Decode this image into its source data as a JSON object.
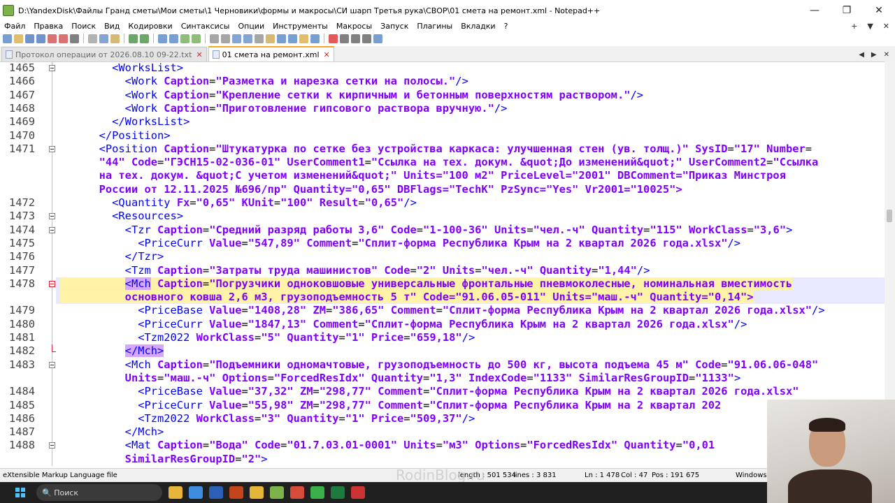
{
  "window": {
    "title": "D:\\YandexDisk\\Файлы Гранд сметы\\Мои сметы\\1 Черновики\\формы и макросы\\СИ шарп Третья рука\\СВОР\\01 смета на ремонт.xml - Notepad++",
    "minimize": "—",
    "maximize": "❐",
    "close": "✕"
  },
  "menu": {
    "items": [
      "Файл",
      "Правка",
      "Поиск",
      "Вид",
      "Кодировки",
      "Синтаксисы",
      "Опции",
      "Инструменты",
      "Макросы",
      "Запуск",
      "Плагины",
      "Вкладки",
      "?"
    ],
    "right": [
      "+",
      "▼",
      "✕"
    ]
  },
  "toolbar": {
    "icons": [
      "new-file-icon",
      "open-file-icon",
      "save-icon",
      "save-all-icon",
      "close-icon",
      "close-all-icon",
      "print-icon",
      "cut-icon",
      "copy-icon",
      "paste-icon",
      "undo-icon",
      "redo-icon",
      "find-icon",
      "replace-icon",
      "zoom-in-icon",
      "zoom-out-icon",
      "sync-v-icon",
      "sync-h-icon",
      "word-wrap-icon",
      "show-all-chars-icon",
      "indent-guide-icon",
      "udl-icon",
      "doc-map-icon",
      "function-list-icon",
      "folder-workspace-icon",
      "monitor-icon",
      "record-icon",
      "stop-icon",
      "play-icon",
      "play-multi-icon",
      "save-macro-icon"
    ],
    "colors": [
      "#4a7fc1",
      "#d8a73a",
      "#3f6fb8",
      "#3f6fb8",
      "#c44",
      "#c44",
      "#555",
      "#999",
      "#5b87c5",
      "#c8a04a",
      "#3a8a3a",
      "#3a8a3a",
      "#4a7fc1",
      "#4a7fc1",
      "#6aa84f",
      "#6aa84f",
      "#888",
      "#888",
      "#5b87c5",
      "#5b87c5",
      "#888",
      "#c8a04a",
      "#4a7fc1",
      "#4a7fc1",
      "#d8a73a",
      "#4a7fc1",
      "#d22",
      "#555",
      "#555",
      "#555",
      "#4a7fc1"
    ]
  },
  "tabs": [
    {
      "label": "Протокол операции от 2026.08.10 09-22.txt",
      "close": "✕",
      "active": false
    },
    {
      "label": "01 смета на ремонт.xml",
      "close": "✕",
      "active": true
    }
  ],
  "tab_arrows": [
    "◀",
    "▶",
    "✕"
  ],
  "editor": {
    "lines": [
      {
        "n": "1465",
        "fold": "box",
        "text": "        <WorksList>"
      },
      {
        "n": "1466",
        "fold": "line",
        "text": "          <Work Caption=\"Разметка и нарезка сетки на полосы.\"/>"
      },
      {
        "n": "1467",
        "fold": "line",
        "text": "          <Work Caption=\"Крепление сетки к кирпичным и бетонным поверхностям раствором.\"/>"
      },
      {
        "n": "1468",
        "fold": "line",
        "text": "          <Work Caption=\"Приготовление гипсового раствора вручную.\"/>"
      },
      {
        "n": "1469",
        "fold": "line",
        "text": "        </WorksList>"
      },
      {
        "n": "1470",
        "fold": "line",
        "text": "      </Position>"
      },
      {
        "n": "1471",
        "fold": "box",
        "text": "      <Position Caption=\"Штукатурка по сетке без устройства каркаса: улучшенная стен (ув. толщ.)\" SysID=\"17\" Number="
      },
      {
        "n": "",
        "fold": "line",
        "text": "      \"44\" Code=\"ГЭСН15-02-036-01\" UserComment1=\"Ссылка на тех. докум. &quot;До изменений&quot;\" UserComment2=\"Ссылка"
      },
      {
        "n": "",
        "fold": "line",
        "text": "      на тех. докум. &quot;С учетом изменений&quot;\" Units=\"100 м2\" PriceLevel=\"2001\" DBComment=\"Приказ Минстроя"
      },
      {
        "n": "",
        "fold": "line",
        "text": "      России от 12.11.2025 №696/пр\" Quantity=\"0,65\" DBFlags=\"TechK\" PzSync=\"Yes\" Vr2001=\"10025\">"
      },
      {
        "n": "1472",
        "fold": "line",
        "text": "        <Quantity Fx=\"0,65\" KUnit=\"100\" Result=\"0,65\"/>"
      },
      {
        "n": "1473",
        "fold": "box",
        "text": "        <Resources>"
      },
      {
        "n": "1474",
        "fold": "box",
        "text": "          <Tzr Caption=\"Средний разряд работы 3,6\" Code=\"1-100-36\" Units=\"чел.-ч\" Quantity=\"115\" WorkClass=\"3,6\">"
      },
      {
        "n": "1475",
        "fold": "line",
        "text": "            <PriceCurr Value=\"547,89\" Comment=\"Сплит-форма Республика Крым на 2 квартал 2026 года.xlsx\"/>"
      },
      {
        "n": "1476",
        "fold": "line",
        "text": "          </Tzr>"
      },
      {
        "n": "1477",
        "fold": "line",
        "text": "          <Tzm Caption=\"Затраты труда машинистов\" Code=\"2\" Units=\"чел.-ч\" Quantity=\"1,44\"/>"
      },
      {
        "n": "1478",
        "fold": "red",
        "hl": true,
        "text": "          <Mch Caption=\"Погрузчики одноковшовые универсальные фронтальные пневмоколесные, номинальная вместимость"
      },
      {
        "n": "",
        "fold": "line",
        "hl": true,
        "text": "          основного ковша 2,6 м3, грузоподъемность 5 т\" Code=\"91.06.05-011\" Units=\"маш.-ч\" Quantity=\"0,14\">"
      },
      {
        "n": "1479",
        "fold": "line",
        "text": "            <PriceBase Value=\"1408,28\" ZM=\"386,65\" Comment=\"Сплит-форма Республика Крым на 2 квартал 2026 года.xlsx\"/>"
      },
      {
        "n": "1480",
        "fold": "line",
        "text": "            <PriceCurr Value=\"1847,13\" Comment=\"Сплит-форма Республика Крым на 2 квартал 2026 года.xlsx\"/>"
      },
      {
        "n": "1481",
        "fold": "line",
        "text": "            <Tzm2022 WorkClass=\"5\" Quantity=\"1\" Price=\"659,18\"/>"
      },
      {
        "n": "1482",
        "fold": "red-end",
        "text": "          </Mch>"
      },
      {
        "n": "1483",
        "fold": "box",
        "text": "          <Mch Caption=\"Подъемники одномачтовые, грузоподъемность до 500 кг, высота подъема 45 м\" Code=\"91.06.06-048\""
      },
      {
        "n": "",
        "fold": "line",
        "text": "          Units=\"маш.-ч\" Options=\"ForcedResIdx\" Quantity=\"1,3\" IndexCode=\"1133\" SimilarResGroupID=\"1133\">"
      },
      {
        "n": "1484",
        "fold": "line",
        "text": "            <PriceBase Value=\"37,32\" ZM=\"298,77\" Comment=\"Сплит-форма Республика Крым на 2 квартал 2026 года.xlsx\""
      },
      {
        "n": "1485",
        "fold": "line",
        "text": "            <PriceCurr Value=\"55,98\" ZM=\"298,77\" Comment=\"Сплит-форма Республика Крым на 2 квартал 202"
      },
      {
        "n": "1486",
        "fold": "line",
        "text": "            <Tzm2022 WorkClass=\"3\" Quantity=\"1\" Price=\"509,37\"/>"
      },
      {
        "n": "1487",
        "fold": "line",
        "text": "          </Mch>"
      },
      {
        "n": "1488",
        "fold": "box",
        "text": "          <Mat Caption=\"Вода\" Code=\"01.7.03.01-0001\" Units=\"м3\" Options=\"ForcedResIdx\" Quantity=\"0,01"
      },
      {
        "n": "",
        "fold": "line",
        "text": "          SimilarResGroupID=\"2\">"
      }
    ]
  },
  "status": {
    "file_type": "eXtensible Markup Language file",
    "length": "length : 501 534",
    "lines": "lines : 3 831",
    "ln": "Ln : 1 478",
    "col": "Col : 47",
    "pos": "Pos : 191 675",
    "eol": "Windows"
  },
  "watermark": "RodinBlog.ru",
  "taskbar": {
    "search_placeholder": "Поиск",
    "apps": [
      "file-explorer-icon",
      "chrome-icon",
      "word-icon",
      "powerpoint-icon",
      "folder-icon",
      "notepadpp-icon",
      "app-icon",
      "app-icon",
      "excel-icon",
      "app-icon"
    ],
    "app_colors": [
      "#e7b53a",
      "#3f8de0",
      "#2b5fb8",
      "#c4451c",
      "#e7b53a",
      "#7db34a",
      "#d64a3a",
      "#3ab04a",
      "#1e7a3e",
      "#c33"
    ]
  }
}
